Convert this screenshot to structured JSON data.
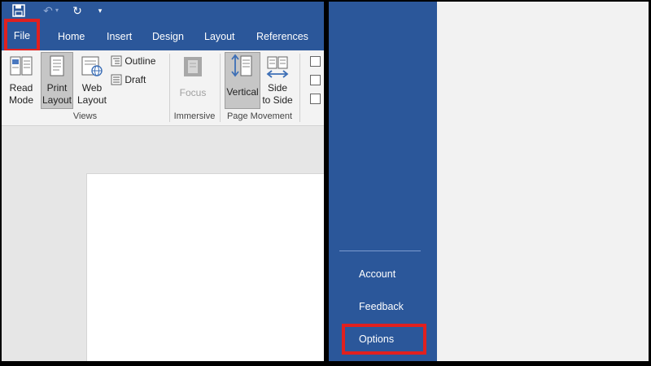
{
  "ribbon_tabs": {
    "file": "File",
    "home": "Home",
    "insert": "Insert",
    "design": "Design",
    "layout": "Layout",
    "references": "References"
  },
  "views_group": {
    "label": "Views",
    "read_mode": [
      "Read",
      "Mode"
    ],
    "print_layout": [
      "Print",
      "Layout"
    ],
    "web_layout": [
      "Web",
      "Layout"
    ],
    "outline": "Outline",
    "draft": "Draft"
  },
  "immersive_group": {
    "label": "Immersive",
    "focus": "Focus"
  },
  "page_movement_group": {
    "label": "Page Movement",
    "vertical": "Vertical",
    "side_to_side": [
      "Side",
      "to Side"
    ]
  },
  "backstage_nav": {
    "account": "Account",
    "feedback": "Feedback",
    "options": "Options"
  },
  "colors": {
    "word_blue": "#2b579a",
    "highlight_red": "#e0201f"
  }
}
